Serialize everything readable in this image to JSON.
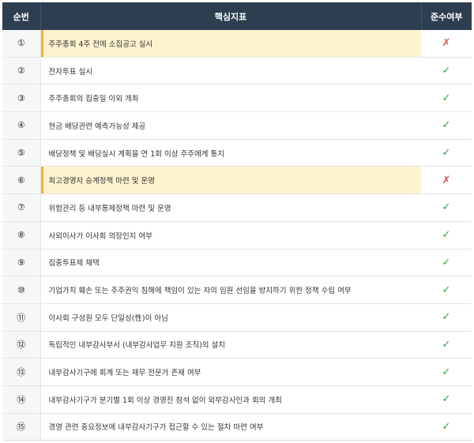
{
  "header": {
    "col_number": "순번",
    "col_indicator": "핵심지표",
    "col_compliance": "준수여부"
  },
  "colors": {
    "header_bg": "#2c3e50",
    "highlight_bg": "#fdf3cf",
    "highlight_accent": "#f0b32a",
    "pass": "#2e9e44",
    "fail": "#d9534f"
  },
  "marks": {
    "pass": "✓",
    "fail": "✗"
  },
  "rows": [
    {
      "number": "①",
      "indicator": "주주총회 4주 전에 소집공고 실시",
      "status": "fail",
      "highlight": true
    },
    {
      "number": "②",
      "indicator": "전자투표 실시",
      "status": "pass",
      "highlight": false
    },
    {
      "number": "③",
      "indicator": "주주총회의 집중일 이외 개최",
      "status": "pass",
      "highlight": false
    },
    {
      "number": "④",
      "indicator": "현금 배당관련 예측가능성 제공",
      "status": "pass",
      "highlight": false
    },
    {
      "number": "⑤",
      "indicator": "배당정책 및 배당실시 계획을 연 1회 이상 주주에게 통지",
      "status": "pass",
      "highlight": false
    },
    {
      "number": "⑥",
      "indicator": "최고경영자 승계정책 마련 및 운영",
      "status": "fail",
      "highlight": true
    },
    {
      "number": "⑦",
      "indicator": "위험관리 등 내부통제정책 마련 및 운영",
      "status": "pass",
      "highlight": false
    },
    {
      "number": "⑧",
      "indicator": "사외이사가 이사회 의장인지 여부",
      "status": "pass",
      "highlight": false
    },
    {
      "number": "⑨",
      "indicator": "집중투표제 채택",
      "status": "pass",
      "highlight": false
    },
    {
      "number": "⑩",
      "indicator": "기업가치 훼손 또는 주주권익 침해에 책임이 있는 자의 임원 선임을 방지하기 위한 정책 수립 여부",
      "status": "pass",
      "highlight": false
    },
    {
      "number": "⑪",
      "indicator": "이사회 구성원 모두 단일성(性)이 아님",
      "status": "pass",
      "highlight": false
    },
    {
      "number": "⑫",
      "indicator": "독립적인 내부감사부서 (내부감사업무 지원 조직)의 설치",
      "status": "pass",
      "highlight": false
    },
    {
      "number": "⑬",
      "indicator": "내부감사기구에 회계 또는 재무 전문가 존재 여부",
      "status": "pass",
      "highlight": false
    },
    {
      "number": "⑭",
      "indicator": "내부감사기구가 분기별 1회 이상 경영진 참석 없이 외부감사인과 회의 개최",
      "status": "pass",
      "highlight": false
    },
    {
      "number": "⑮",
      "indicator": "경영 관련 중요정보에 내부감사기구가 접근할 수 있는 절차 마련 여부",
      "status": "pass",
      "highlight": false
    }
  ]
}
